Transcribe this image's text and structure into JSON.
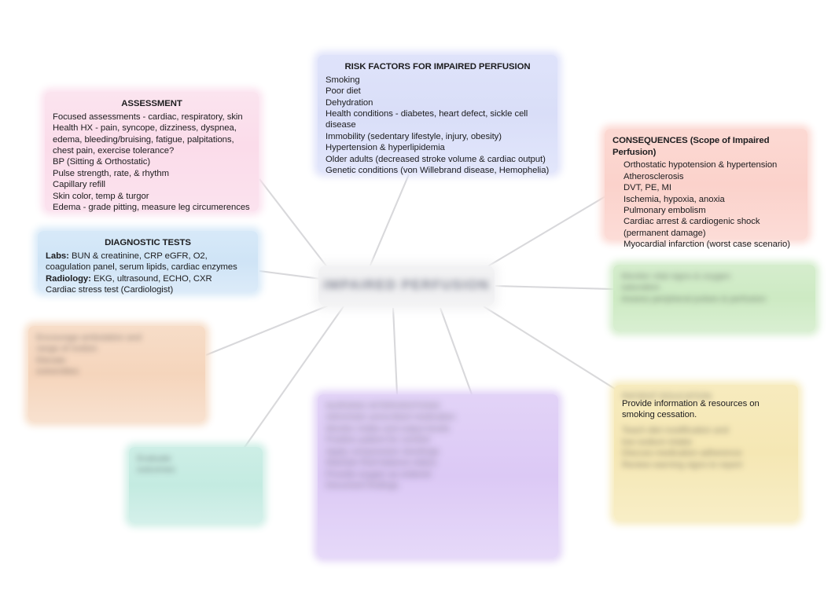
{
  "map": {
    "center_node": {
      "text": "IMPAIRED PERFUSION",
      "redacted": true
    }
  },
  "nodes": {
    "assessment": {
      "title": "ASSESSMENT",
      "color": "#fbdcea",
      "items": [
        "Focused assessments - cardiac, respiratory, skin",
        "Health HX - pain, syncope, dizziness, dyspnea, edema, bleeding/bruising, fatigue, palpitations, chest pain, exercise tolerance?",
        "BP (Sitting & Orthostatic)",
        "Pulse strength, rate, & rhythm",
        "Capillary refill",
        "Skin color, temp & turgor",
        "Edema - grade pitting, measure leg circumerences"
      ]
    },
    "risk_factors": {
      "title": "RISK FACTORS FOR IMPAIRED PERFUSION",
      "color": "#d9def8",
      "items": [
        "Smoking",
        "Poor diet",
        "Dehydration",
        "Health conditions - diabetes, heart defect, sickle cell disease",
        "Immobility (sedentary lifestyle, injury, obesity)",
        "Hypertension & hyperlipidemia",
        "Older adults (decreased stroke volume & cardiac output)",
        "Genetic conditions (von Willebrand disease, Hemophelia)"
      ]
    },
    "consequences": {
      "title": "CONSEQUENCES (Scope of Impaired  Perfusion)",
      "color": "#fbd2cb",
      "items": [
        "Orthostatic hypotension & hypertension",
        "Atherosclerosis",
        "DVT, PE, MI",
        "Ischemia, hypoxia, anoxia",
        "Pulmonary embolism",
        "Cardiac arrest & cardiogenic shock (permanent damage)",
        "Myocardial infarction (worst case  scenario)"
      ]
    },
    "diagnostic_tests": {
      "title": "DIAGNOSTIC TESTS",
      "color": "#cfe4f6",
      "labs_label": "Labs:",
      "labs_text": " BUN & creatinine, CRP eGFR, O2, coagulation panel, serum lipids, cardiac enzymes",
      "radiology_label": "Radiology:",
      "radiology_text": " EKG, ultrasound, ECHO, CXR",
      "extra": "Cardiac stress test (Cardiologist)"
    },
    "green": {
      "color": "#cdeac3",
      "redacted": true,
      "lines": [
        "Monitor vital signs & oxygen",
        "saturation",
        "Assess peripheral pulses & perfusion"
      ]
    },
    "orange": {
      "color": "#f5d5bc",
      "redacted": true,
      "lines": [
        "Encourage ambulation and",
        "range of motion",
        "Elevate",
        "extremities"
      ]
    },
    "yellow": {
      "color": "#f5e7b4",
      "redacted": true,
      "visible_text": "Provide information & resources on smoking cessation.",
      "lines": [
        "PATIENT EDUCATION",
        "",
        "",
        "Teach diet modification and",
        "low sodium intake",
        "Discuss medication adherence",
        "Review warning signs to report"
      ]
    },
    "purple": {
      "color": "#dcc9f5",
      "redacted": true,
      "lines": [
        "NURSING INTERVENTIONS",
        "Administer prescribed medication",
        "Monitor intake and output levels",
        "Position patient for comfort",
        "Apply compression stockings",
        "Maintain fluid balance status",
        "Provide oxygen as ordered",
        "Document findings"
      ]
    },
    "teal": {
      "color": "#c4ebe1",
      "redacted": true,
      "lines": [
        "Evaluate",
        "outcomes"
      ]
    }
  },
  "connections": [
    {
      "from": "center",
      "to": "assessment"
    },
    {
      "from": "center",
      "to": "risk_factors"
    },
    {
      "from": "center",
      "to": "consequences"
    },
    {
      "from": "center",
      "to": "diagnostic_tests"
    },
    {
      "from": "center",
      "to": "green"
    },
    {
      "from": "center",
      "to": "orange"
    },
    {
      "from": "center",
      "to": "yellow"
    },
    {
      "from": "center",
      "to": "purple"
    },
    {
      "from": "center",
      "to": "teal"
    }
  ]
}
